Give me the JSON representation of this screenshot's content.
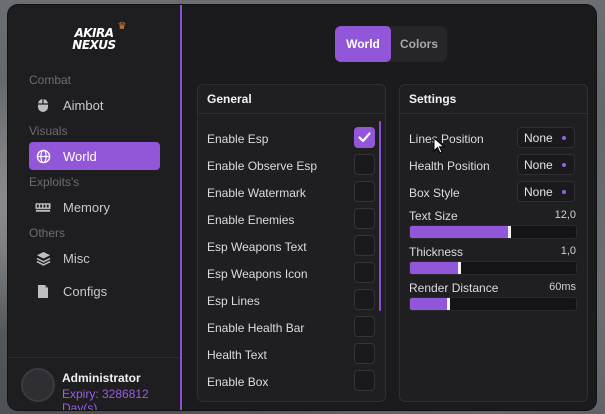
{
  "app": {
    "logo_line1": "AKIRA",
    "logo_line2": "NEXUS"
  },
  "sidebar": {
    "sections": [
      {
        "label": "Combat"
      },
      {
        "label": "Visuals"
      },
      {
        "label": "Exploits's"
      },
      {
        "label": "Others"
      }
    ],
    "items": [
      {
        "label": "Aimbot",
        "icon": "mouse-icon",
        "active": false
      },
      {
        "label": "World",
        "icon": "globe-icon",
        "active": true
      },
      {
        "label": "Memory",
        "icon": "memory-chip-icon",
        "active": false
      },
      {
        "label": "Misc",
        "icon": "layers-icon",
        "active": false
      },
      {
        "label": "Configs",
        "icon": "file-icon",
        "active": false
      }
    ]
  },
  "user": {
    "name": "Administrator",
    "expiry": "Expiry: 3286812 Day(s)"
  },
  "tabs": [
    {
      "label": "World",
      "active": true
    },
    {
      "label": "Colors",
      "active": false
    }
  ],
  "general": {
    "title": "General",
    "options": [
      {
        "label": "Enable Esp",
        "checked": true
      },
      {
        "label": "Enable Observe Esp",
        "checked": false
      },
      {
        "label": "Enable Watermark",
        "checked": false
      },
      {
        "label": "Enable Enemies",
        "checked": false
      },
      {
        "label": "Esp Weapons Text",
        "checked": false
      },
      {
        "label": "Esp Weapons Icon",
        "checked": false
      },
      {
        "label": "Esp Lines",
        "checked": false
      },
      {
        "label": "Enable Health Bar",
        "checked": false
      },
      {
        "label": "Health Text",
        "checked": false
      },
      {
        "label": "Enable Box",
        "checked": false
      }
    ]
  },
  "settings": {
    "title": "Settings",
    "dropdowns": [
      {
        "label": "Lines Position",
        "value": "None"
      },
      {
        "label": "Health Position",
        "value": "None"
      },
      {
        "label": "Box Style",
        "value": "None"
      }
    ],
    "sliders": [
      {
        "label": "Text Size",
        "value": "12,0",
        "fraction": 0.61
      },
      {
        "label": "Thickness",
        "value": "1,0",
        "fraction": 0.31
      },
      {
        "label": "Render Distance",
        "value": "60ms",
        "fraction": 0.24
      }
    ]
  },
  "colors": {
    "accent": "#9256d8",
    "panel": "#1f1f22",
    "window": "#1b1b1e"
  }
}
